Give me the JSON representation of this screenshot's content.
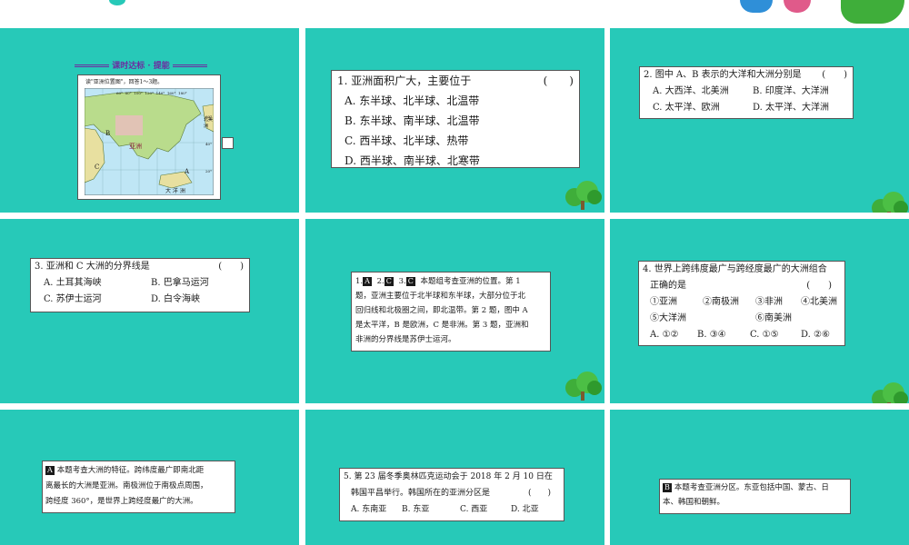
{
  "slides": {
    "s1": {
      "heading": "课时达标 · 提能",
      "instruction": "读\"亚洲位置图\"，回答1～3题。",
      "map": {
        "lat_labels": [
          "60°",
          "40°",
          "20°"
        ],
        "lon_labels": [
          "60°",
          "80°",
          "100°",
          "120°",
          "140°",
          "160°",
          "180°"
        ],
        "label_b": "B",
        "label_c": "C",
        "label_a": "A",
        "region_label": "亚洲",
        "ocean_label": "大 洋 洲",
        "right_label": "北美洲"
      }
    },
    "s2": {
      "question": "1. 亚洲面积广大，主要位于",
      "paren": "(　　)",
      "options": [
        "A. 东半球、北半球、北温带",
        "B. 东半球、南半球、北温带",
        "C. 西半球、北半球、热带",
        "D. 西半球、南半球、北寒带"
      ]
    },
    "s3": {
      "question": "2. 图中 A、B 表示的大洋和大洲分别是",
      "paren": "(　　)",
      "options": [
        "A. 大西洋、北美洲",
        "B. 印度洋、大洋洲",
        "C. 太平洋、欧洲",
        "D. 太平洋、大洋洲"
      ]
    },
    "s4": {
      "question": "3. 亚洲和 C 大洲的分界线是",
      "paren": "(　　)",
      "options": [
        "A. 土耳其海峡",
        "B. 巴拿马运河",
        "C. 苏伊士运河",
        "D. 白令海峡"
      ]
    },
    "s5": {
      "badges": [
        "A",
        "C",
        "C"
      ],
      "nums": [
        "1.",
        "2.",
        "3."
      ],
      "lines": [
        "本题组考查亚洲的位置。第 1",
        "题，亚洲主要位于北半球和东半球，大部分位于北",
        "回归线和北极圈之间，即北温带。第 2 题，图中 A",
        "是太平洋，B 是欧洲，C 是非洲。第 3 题，亚洲和",
        "非洲的分界线是苏伊士运河。"
      ]
    },
    "s6": {
      "question": "4. 世界上跨纬度最广与跨经度最广的大洲组合",
      "question2": "正确的是",
      "paren": "(　　)",
      "items": [
        "①亚洲",
        "②南极洲",
        "③非洲",
        "④北美洲",
        "⑤大洋洲",
        "⑥南美洲"
      ],
      "options": [
        "A. ①②",
        "B. ③④",
        "C. ①⑤",
        "D. ②⑥"
      ]
    },
    "s7": {
      "badge": "A",
      "lines": [
        "本题考查大洲的特征。跨纬度最广即南北距",
        "离最长的大洲是亚洲。南极洲位于南极点周围，",
        "跨经度 360°，是世界上跨经度最广的大洲。"
      ]
    },
    "s8": {
      "question": "5. 第 23 届冬季奥林匹克运动会于 2018 年 2 月 10 日在",
      "question2": "韩国平昌举行。韩国所在的亚洲分区是",
      "paren": "(　　)",
      "options": [
        "A. 东南亚",
        "B. 东亚",
        "C. 西亚",
        "D. 北亚"
      ]
    },
    "s9": {
      "badge": "B",
      "lines": [
        "本题考查亚洲分区。东亚包括中国、蒙古、日",
        "本、韩国和朝鲜。"
      ]
    }
  },
  "colors": {
    "slide_bg": "#27c9b8",
    "tree_green": "#3fae3a"
  }
}
